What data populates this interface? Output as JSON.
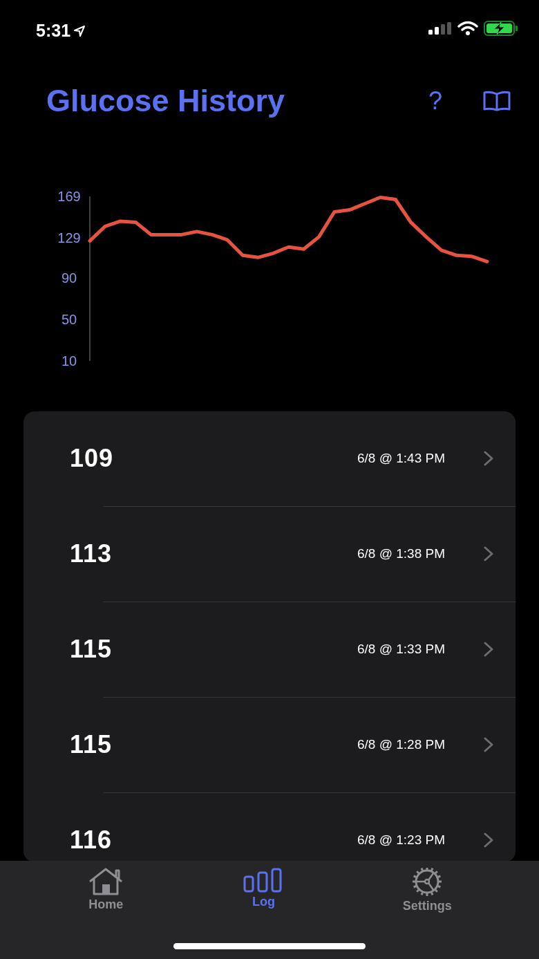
{
  "status_bar": {
    "time": "5:31"
  },
  "header": {
    "title": "Glucose History",
    "help_button": "?"
  },
  "chart_data": {
    "type": "line",
    "ylim": [
      10,
      169
    ],
    "yticks": [
      10,
      50,
      90,
      129,
      169
    ],
    "series": [
      {
        "color": "#e8533f",
        "values": [
          126,
          140,
          145,
          144,
          132,
          132,
          132,
          135,
          132,
          127,
          112,
          110,
          114,
          120,
          118,
          130,
          154,
          156,
          162,
          168,
          166,
          144,
          130,
          117,
          112,
          111,
          106
        ]
      }
    ]
  },
  "readings": [
    {
      "value": "109",
      "time": "6/8 @ 1:43 PM"
    },
    {
      "value": "113",
      "time": "6/8 @ 1:38 PM"
    },
    {
      "value": "115",
      "time": "6/8 @ 1:33 PM"
    },
    {
      "value": "115",
      "time": "6/8 @ 1:28 PM"
    },
    {
      "value": "116",
      "time": "6/8 @ 1:23 PM"
    }
  ],
  "tabs": [
    {
      "label": "Home",
      "kind": "home",
      "selected": false
    },
    {
      "label": "Log",
      "kind": "log",
      "selected": true
    },
    {
      "label": "Settings",
      "kind": "settings",
      "selected": false
    }
  ]
}
